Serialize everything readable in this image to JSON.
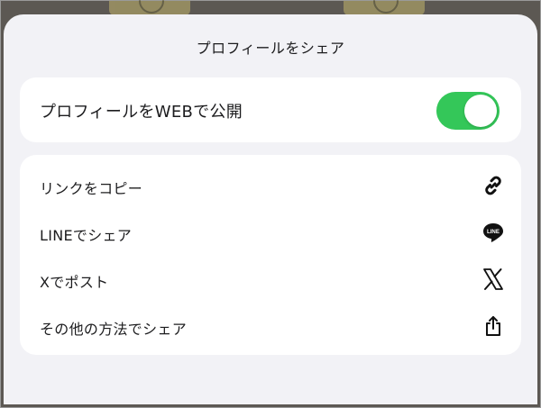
{
  "sheet": {
    "title": "プロフィールをシェア"
  },
  "publish": {
    "label": "プロフィールをWEBで公開",
    "toggle_on": true,
    "toggle_color": "#34C759"
  },
  "actions": [
    {
      "label": "リンクをコピー",
      "icon": "link-icon"
    },
    {
      "label": "LINEでシェア",
      "icon": "line-icon"
    },
    {
      "label": "Xでポスト",
      "icon": "x-logo-icon"
    },
    {
      "label": "その他の方法でシェア",
      "icon": "share-icon"
    }
  ],
  "line_icon_text": "LINE"
}
